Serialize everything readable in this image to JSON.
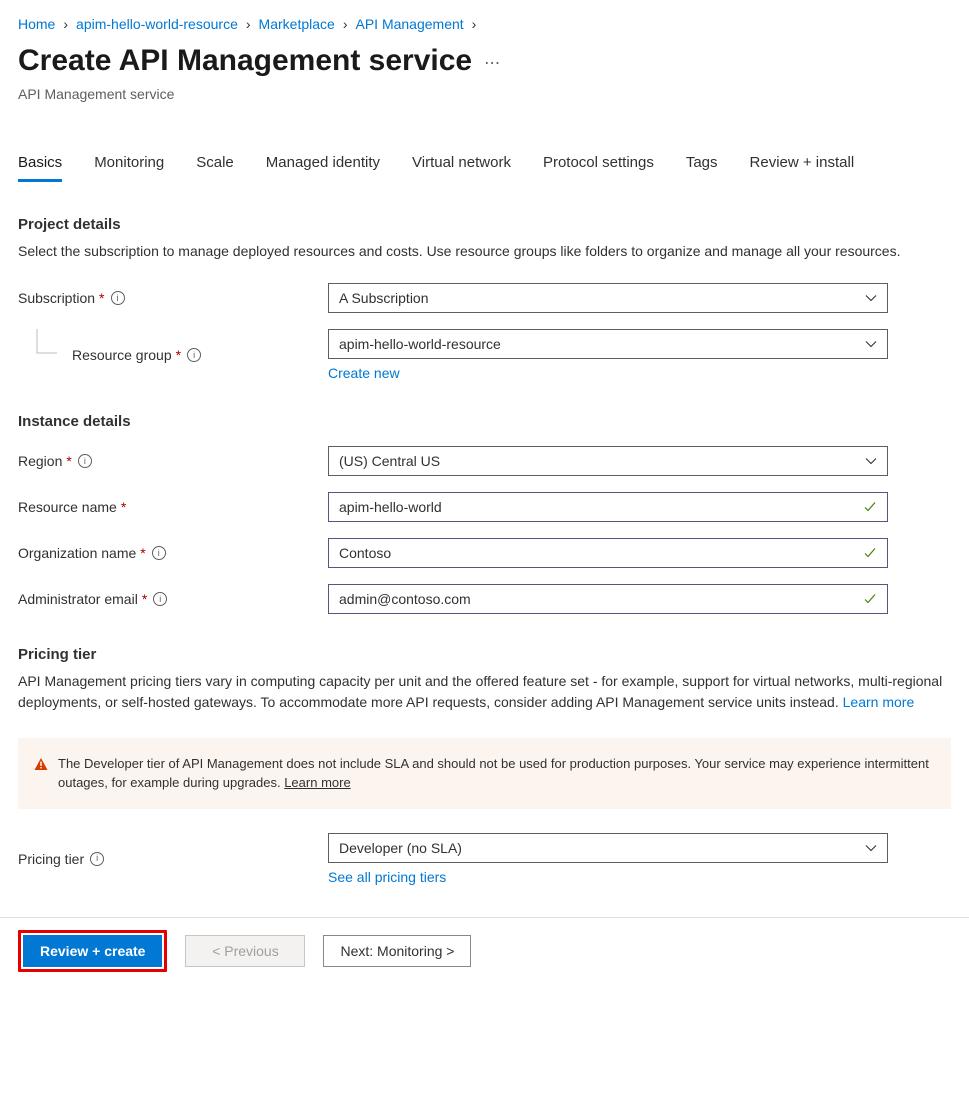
{
  "breadcrumb": [
    "Home",
    "apim-hello-world-resource",
    "Marketplace",
    "API Management"
  ],
  "header": {
    "title": "Create API Management service",
    "subtitle": "API Management service"
  },
  "tabs": [
    "Basics",
    "Monitoring",
    "Scale",
    "Managed identity",
    "Virtual network",
    "Protocol settings",
    "Tags",
    "Review + install"
  ],
  "projectDetails": {
    "heading": "Project details",
    "desc": "Select the subscription to manage deployed resources and costs. Use resource groups like folders to organize and manage all your resources.",
    "subscriptionLabel": "Subscription",
    "subscriptionValue": "A Subscription",
    "resourceGroupLabel": "Resource group",
    "resourceGroupValue": "apim-hello-world-resource",
    "createNew": "Create new"
  },
  "instanceDetails": {
    "heading": "Instance details",
    "regionLabel": "Region",
    "regionValue": "(US) Central US",
    "resourceNameLabel": "Resource name",
    "resourceNameValue": "apim-hello-world",
    "orgNameLabel": "Organization name",
    "orgNameValue": "Contoso",
    "adminEmailLabel": "Administrator email",
    "adminEmailValue": "admin@contoso.com"
  },
  "pricingTier": {
    "heading": "Pricing tier",
    "desc": "API Management pricing tiers vary in computing capacity per unit and the offered feature set - for example, support for virtual networks, multi-regional deployments, or self-hosted gateways. To accommodate more API requests, consider adding API Management service units instead. ",
    "learnMore": "Learn more",
    "warningText": "The Developer tier of API Management does not include SLA and should not be used for production purposes. Your service may experience intermittent outages, for example during upgrades. ",
    "warningLink": "Learn more",
    "tierLabel": "Pricing tier",
    "tierValue": "Developer (no SLA)",
    "seeAll": "See all pricing tiers"
  },
  "footer": {
    "reviewCreate": "Review + create",
    "previous": "< Previous",
    "next": "Next: Monitoring >"
  }
}
